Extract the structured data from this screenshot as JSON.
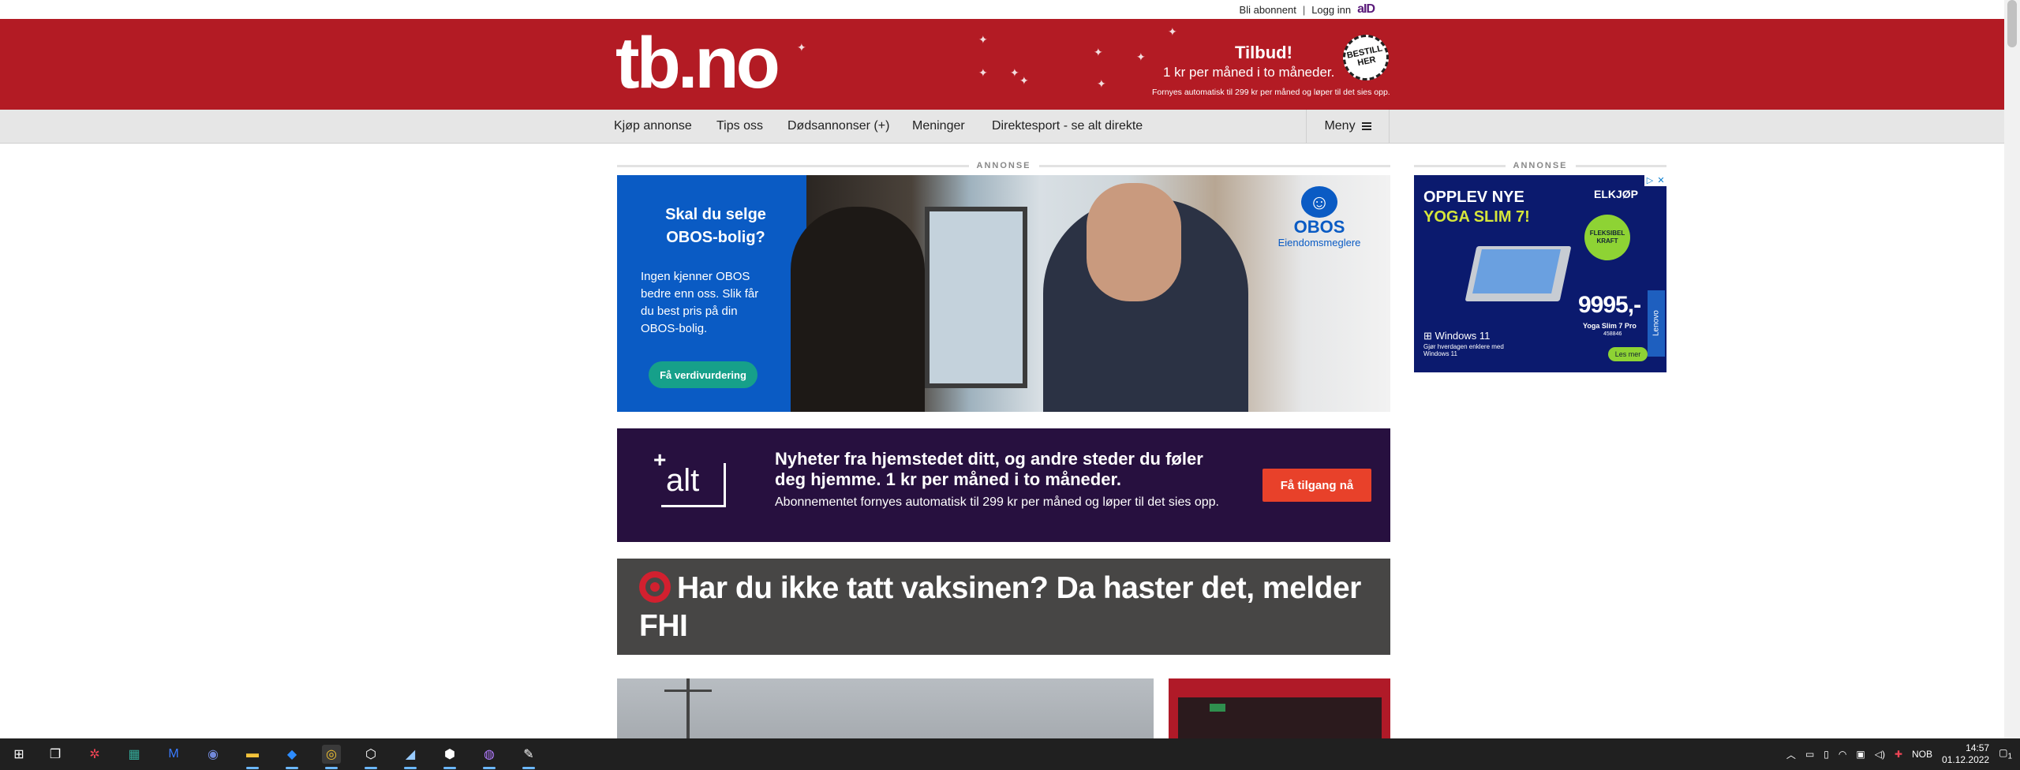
{
  "topbar": {
    "subscribe": "Bli abonnent",
    "separator": "|",
    "login": "Logg inn",
    "aid": "aID"
  },
  "header": {
    "logo": "tb.no",
    "promo_title": "Tilbud!",
    "promo_sub": "1 kr per måned i to måneder.",
    "promo_fine": "Fornyes automatisk til 299 kr per måned og løper til det sies opp.",
    "badge_line1": "BESTILL",
    "badge_line2": "HER",
    "brand_color": "#b31b24"
  },
  "nav": {
    "items": [
      "Kjøp annonse",
      "Tips oss",
      "Dødsannonser (+)",
      "Meninger",
      "Direktesport - se alt direkte"
    ],
    "menu": "Meny"
  },
  "ads": {
    "label": "ANNONSE",
    "obos": {
      "heading": "Skal du selge OBOS-bolig?",
      "body": "Ingen kjenner OBOS bedre enn oss. Slik får du best pris på din OBOS-bolig.",
      "button": "Få verdivurdering",
      "logo_name": "OBOS",
      "logo_sub": "Eiendomsmeglere"
    },
    "elkjop": {
      "heading_line1": "OPPLEV NYE",
      "heading_line2": "YOGA SLIM 7!",
      "brand": "ELKJØP",
      "badge": "FLEKSIBEL KRAFT",
      "price": "9995,-",
      "model": "Yoga Slim 7 Pro",
      "model_no": "458846",
      "windows": "Windows 11",
      "windows_sub": "Gjør hverdagen enklere med Windows 11",
      "button": "Les mer",
      "vertical_brand": "Lenovo"
    }
  },
  "alt_banner": {
    "logo_plus": "+",
    "logo_text": "alt",
    "heading": "Nyheter fra hjemstedet ditt, og andre steder du føler deg hjemme. 1 kr per måned i to måneder.",
    "body": "Abonnementet fornyes automatisk til 299 kr per måned og løper til det sies opp.",
    "button": "Få tilgang nå"
  },
  "headline": {
    "text": "Har du ikke tatt vaksinen? Da haster det, melder FHI"
  },
  "taskbar": {
    "language": "NOB",
    "time": "14:57",
    "date": "01.12.2022",
    "notifications": "1"
  }
}
